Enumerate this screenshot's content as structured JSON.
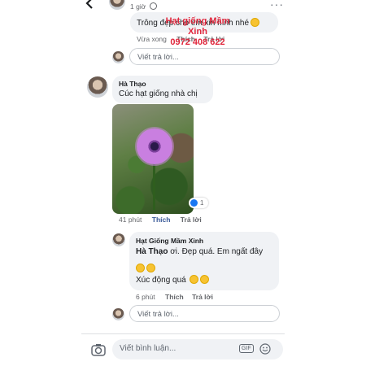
{
  "header": {
    "back_icon": "chevron-left-icon",
    "time_ago": "1 giờ",
    "privacy_icon": "globe-icon",
    "more_icon": "ellipsis-icon"
  },
  "top_comment": {
    "text": "Trông đẹp cho em xin hình nhé",
    "time": "Vừa xong",
    "like_label": "Thích",
    "reply_label": "Trả lời"
  },
  "reply_input_1": {
    "placeholder": "Viết trả lời..."
  },
  "comment_ha_thao": {
    "author": "Hà Thạo",
    "text": "Cúc hạt giống nhà chị",
    "image_watermark": [
      "Hạt giống Mầm",
      "Xinh",
      "0972 408 622"
    ],
    "reaction_count": "1",
    "time": "41 phút",
    "like_label": "Thích",
    "reply_label": "Trả lời"
  },
  "reply_shop": {
    "author": "Hạt Giống Mầm Xinh",
    "mention": "Hà Thạo",
    "text": "ơi. Đẹp quá. Em ngất đây",
    "text2": "Xúc động quá",
    "time": "6 phút",
    "like_label": "Thích",
    "reply_label": "Trả lời"
  },
  "reply_input_2": {
    "placeholder": "Viết trả lời..."
  },
  "composer": {
    "camera_icon": "camera-icon",
    "placeholder": "Viết bình luận...",
    "gif_label": "GIF",
    "emoji_icon": "smiley-icon",
    "send_icon": "send-icon"
  },
  "colors": {
    "link_blue": "#385898",
    "like_blue": "#1877f2",
    "watermark_red": "#e0263c"
  }
}
